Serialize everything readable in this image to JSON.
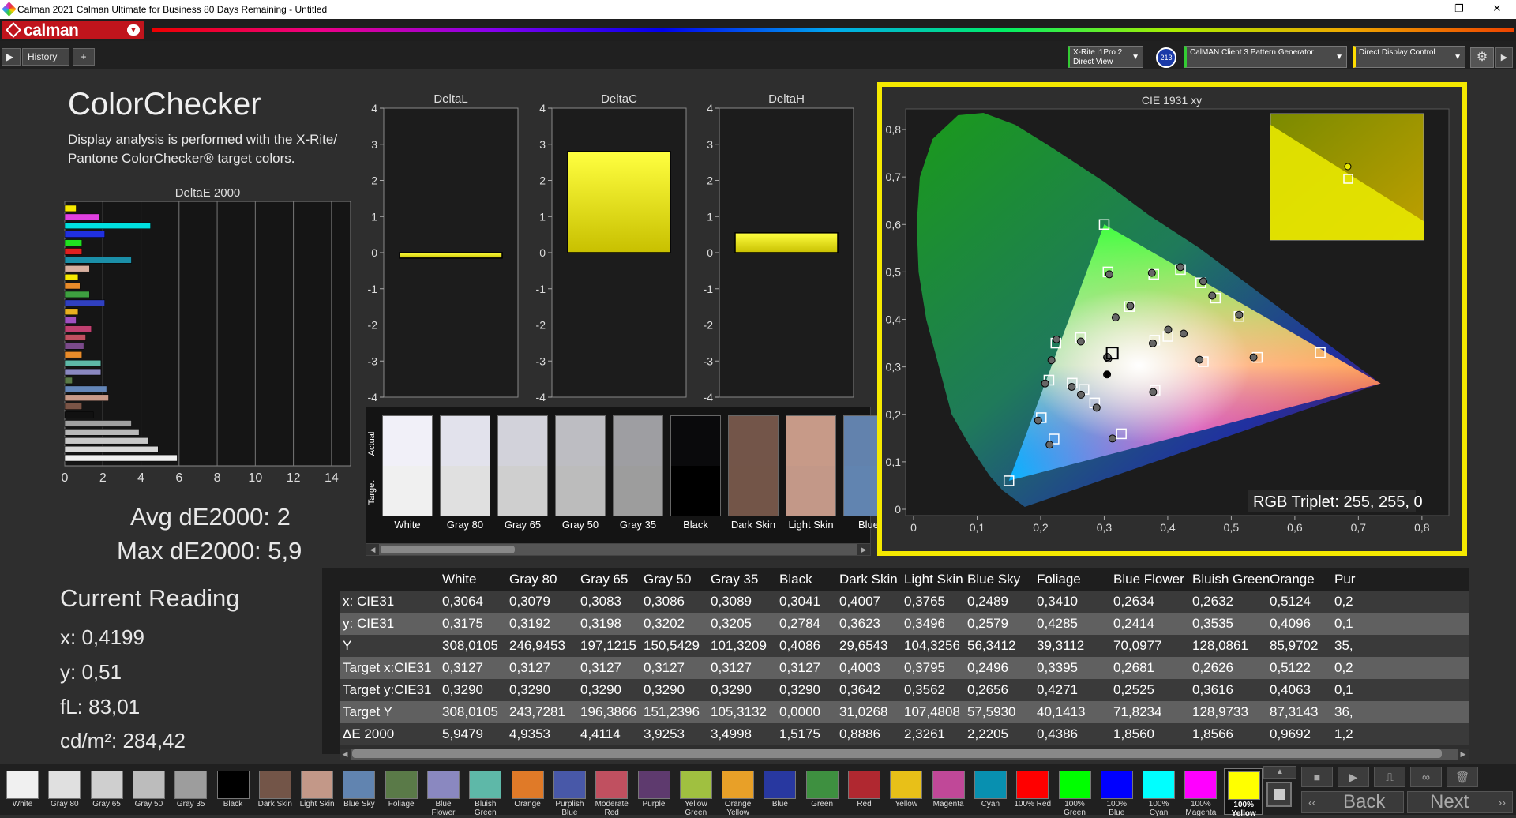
{
  "window": {
    "title": "Calman 2021 Calman Ultimate for Business 80 Days Remaining  - Untitled",
    "minimize": "—",
    "maximize": "❐",
    "close": "✕"
  },
  "brand": {
    "name": "calman",
    "accent": "#c0141c"
  },
  "history": {
    "play": "▶",
    "tab": "History 1",
    "add": "+"
  },
  "devices": [
    {
      "line1": "X-Rite i1Pro 2",
      "line2": "Direct View",
      "badge": "213"
    },
    {
      "line1": "CalMAN Client 3 Pattern Generator",
      "line2": ""
    },
    {
      "line1": "Direct Display Control",
      "line2": ""
    }
  ],
  "settings_icon": "gear-icon",
  "panel": {
    "title": "ColorChecker",
    "description_1": "Display analysis is performed with the X-Rite/",
    "description_2": "Pantone ColorChecker® target colors.",
    "avg": "Avg dE2000: 2",
    "max": "Max dE2000: 5,9",
    "current_reading": "Current Reading",
    "x": "x: 0,4199",
    "y": "y: 0,51",
    "fl": "fL: 83,01",
    "cdm2": "cd/m²: 284,42"
  },
  "chart_data": [
    {
      "type": "bar",
      "title": "DeltaE 2000",
      "orientation": "horizontal",
      "xlim": [
        0,
        15
      ],
      "xticks": [
        "0",
        "2",
        "4",
        "6",
        "8",
        "10",
        "12",
        "14"
      ],
      "values": [
        {
          "v": 0.6,
          "c": "#f5e900"
        },
        {
          "v": 1.8,
          "c": "#e040e0"
        },
        {
          "v": 4.5,
          "c": "#00e0e0"
        },
        {
          "v": 2.1,
          "c": "#2030e0"
        },
        {
          "v": 0.9,
          "c": "#20e020"
        },
        {
          "v": 0.9,
          "c": "#e02020"
        },
        {
          "v": 3.5,
          "c": "#1b8fa8"
        },
        {
          "v": 1.3,
          "c": "#d8b0a0"
        },
        {
          "v": 0.7,
          "c": "#f5e900"
        },
        {
          "v": 0.8,
          "c": "#e88b2a"
        },
        {
          "v": 1.3,
          "c": "#3ea040"
        },
        {
          "v": 2.1,
          "c": "#3040c0"
        },
        {
          "v": 0.7,
          "c": "#e8b020"
        },
        {
          "v": 0.6,
          "c": "#a050c0"
        },
        {
          "v": 1.4,
          "c": "#c04070"
        },
        {
          "v": 1.1,
          "c": "#c05060"
        },
        {
          "v": 1.0,
          "c": "#7a4a8a"
        },
        {
          "v": 0.9,
          "c": "#e88b2a"
        },
        {
          "v": 1.9,
          "c": "#5eb8a8"
        },
        {
          "v": 1.9,
          "c": "#8a88c0"
        },
        {
          "v": 0.4,
          "c": "#5a7a48"
        },
        {
          "v": 2.2,
          "c": "#6486b8"
        },
        {
          "v": 2.3,
          "c": "#c89a88"
        },
        {
          "v": 0.9,
          "c": "#7a5446"
        },
        {
          "v": 1.5,
          "c": "#111111"
        },
        {
          "v": 3.5,
          "c": "#a0a0a0"
        },
        {
          "v": 3.9,
          "c": "#b8b8b8"
        },
        {
          "v": 4.4,
          "c": "#c8c8c8"
        },
        {
          "v": 4.9,
          "c": "#d8d8d8"
        },
        {
          "v": 5.9,
          "c": "#f0f0f0"
        }
      ]
    },
    {
      "type": "bar",
      "title": "DeltaL",
      "ylim": [
        -4,
        4
      ],
      "yticks": [
        "4",
        "3",
        "2",
        "1",
        "0",
        "-1",
        "-2",
        "-3",
        "-4"
      ],
      "values": [
        -0.15
      ]
    },
    {
      "type": "bar",
      "title": "DeltaC",
      "ylim": [
        -4,
        4
      ],
      "yticks": [
        "4",
        "3",
        "2",
        "1",
        "0",
        "-1",
        "-2",
        "-3",
        "-4"
      ],
      "values": [
        2.8
      ]
    },
    {
      "type": "bar",
      "title": "DeltaH",
      "ylim": [
        -4,
        4
      ],
      "yticks": [
        "4",
        "3",
        "2",
        "1",
        "0",
        "-1",
        "-2",
        "-3",
        "-4"
      ],
      "values": [
        0.55
      ]
    },
    {
      "type": "scatter",
      "title": "CIE 1931 xy",
      "xlim": [
        0,
        0.85
      ],
      "ylim": [
        0,
        0.85
      ],
      "xticks": [
        "0",
        "0,1",
        "0,2",
        "0,3",
        "0,4",
        "0,5",
        "0,6",
        "0,7",
        "0,8"
      ],
      "yticks": [
        "0",
        "0,1",
        "0,2",
        "0,3",
        "0,4",
        "0,5",
        "0,6",
        "0,7",
        "0,8"
      ],
      "gamut": [
        [
          0.64,
          0.33
        ],
        [
          0.3,
          0.6
        ],
        [
          0.15,
          0.06
        ]
      ],
      "targets": [
        [
          0.64,
          0.33
        ],
        [
          0.3,
          0.6
        ],
        [
          0.15,
          0.06
        ],
        [
          0.3127,
          0.329
        ],
        [
          0.3127,
          0.329
        ],
        [
          0.4003,
          0.3642
        ],
        [
          0.3795,
          0.3562
        ],
        [
          0.2496,
          0.2656
        ],
        [
          0.3395,
          0.4271
        ],
        [
          0.2681,
          0.2525
        ],
        [
          0.2626,
          0.3616
        ],
        [
          0.5122,
          0.4063
        ],
        [
          0.213,
          0.272
        ],
        [
          0.456,
          0.311
        ],
        [
          0.221,
          0.148
        ],
        [
          0.378,
          0.495
        ],
        [
          0.475,
          0.445
        ],
        [
          0.201,
          0.193
        ],
        [
          0.306,
          0.5
        ],
        [
          0.541,
          0.32
        ],
        [
          0.452,
          0.477
        ],
        [
          0.327,
          0.159
        ],
        [
          0.224,
          0.35
        ],
        [
          0.38,
          0.251
        ],
        [
          0.285,
          0.224
        ],
        [
          0.42,
          0.505
        ]
      ],
      "actual": [
        [
          0.3064,
          0.3175
        ],
        [
          0.4007,
          0.3784
        ],
        [
          0.3765,
          0.3496
        ],
        [
          0.2489,
          0.2579
        ],
        [
          0.341,
          0.4285
        ],
        [
          0.2634,
          0.2414
        ],
        [
          0.2632,
          0.3535
        ],
        [
          0.5124,
          0.4096
        ],
        [
          0.217,
          0.314
        ],
        [
          0.45,
          0.315
        ],
        [
          0.214,
          0.136
        ],
        [
          0.375,
          0.498
        ],
        [
          0.47,
          0.45
        ],
        [
          0.196,
          0.187
        ],
        [
          0.308,
          0.495
        ],
        [
          0.535,
          0.32
        ],
        [
          0.456,
          0.48
        ],
        [
          0.313,
          0.149
        ],
        [
          0.225,
          0.358
        ],
        [
          0.377,
          0.247
        ],
        [
          0.288,
          0.214
        ],
        [
          0.3045,
          0.284
        ],
        [
          0.3045,
          0.32
        ],
        [
          0.4199,
          0.51
        ],
        [
          0.425,
          0.37
        ],
        [
          0.318,
          0.404
        ],
        [
          0.207,
          0.265
        ],
        [
          0.305,
          0.321
        ],
        [
          0.69,
          0.705
        ]
      ],
      "annotation": "RGB Triplet: 255, 255, 0"
    }
  ],
  "swatches": [
    {
      "label": "White",
      "actual": "#f1f0f8",
      "target": "#f0f0f0"
    },
    {
      "label": "Gray 80",
      "actual": "#e2e2ec",
      "target": "#e0e0e0"
    },
    {
      "label": "Gray 65",
      "actual": "#d2d2da",
      "target": "#cfcfcf"
    },
    {
      "label": "Gray 50",
      "actual": "#bdbdc2",
      "target": "#bcbcbc"
    },
    {
      "label": "Gray 35",
      "actual": "#9e9ea2",
      "target": "#9d9d9d"
    },
    {
      "label": "Black",
      "actual": "#0a0a0c",
      "target": "#000000"
    },
    {
      "label": "Dark Skin",
      "actual": "#735549",
      "target": "#735548"
    },
    {
      "label": "Light Skin",
      "actual": "#c79a88",
      "target": "#c39888"
    },
    {
      "label": "Blue",
      "actual": "#6282ad",
      "target": "#6184b0"
    }
  ],
  "swatch_axis": {
    "actual": "Actual",
    "target": "Target"
  },
  "table": {
    "columns": [
      "",
      "White",
      "Gray 80",
      "Gray 65",
      "Gray 50",
      "Gray 35",
      "Black",
      "Dark Skin",
      "Light Skin",
      "Blue Sky",
      "Foliage",
      "Blue Flower",
      "Bluish Green",
      "Orange",
      "Pur"
    ],
    "rows": [
      [
        "x: CIE31",
        "0,3064",
        "0,3079",
        "0,3083",
        "0,3086",
        "0,3089",
        "0,3041",
        "0,4007",
        "0,3765",
        "0,2489",
        "0,3410",
        "0,2634",
        "0,2632",
        "0,5124",
        "0,2"
      ],
      [
        "y: CIE31",
        "0,3175",
        "0,3192",
        "0,3198",
        "0,3202",
        "0,3205",
        "0,2784",
        "0,3623",
        "0,3496",
        "0,2579",
        "0,4285",
        "0,2414",
        "0,3535",
        "0,4096",
        "0,1"
      ],
      [
        "Y",
        "308,0105",
        "246,9453",
        "197,1215",
        "150,5429",
        "101,3209",
        "0,4086",
        "29,6543",
        "104,3256",
        "56,3412",
        "39,3112",
        "70,0977",
        "128,0861",
        "85,9702",
        "35,"
      ],
      [
        "Target x:CIE31",
        "0,3127",
        "0,3127",
        "0,3127",
        "0,3127",
        "0,3127",
        "0,3127",
        "0,4003",
        "0,3795",
        "0,2496",
        "0,3395",
        "0,2681",
        "0,2626",
        "0,5122",
        "0,2"
      ],
      [
        "Target y:CIE31",
        "0,3290",
        "0,3290",
        "0,3290",
        "0,3290",
        "0,3290",
        "0,3290",
        "0,3642",
        "0,3562",
        "0,2656",
        "0,4271",
        "0,2525",
        "0,3616",
        "0,4063",
        "0,1"
      ],
      [
        "Target Y",
        "308,0105",
        "243,7281",
        "196,3866",
        "151,2396",
        "105,3132",
        "0,0000",
        "31,0268",
        "107,4808",
        "57,5930",
        "40,1413",
        "71,8234",
        "128,9733",
        "87,3143",
        "36,"
      ],
      [
        "ΔE 2000",
        "5,9479",
        "4,9353",
        "4,4114",
        "3,9253",
        "3,4998",
        "1,5175",
        "0,8886",
        "2,3261",
        "2,2205",
        "0,4386",
        "1,8560",
        "1,8566",
        "0,9692",
        "1,2"
      ]
    ]
  },
  "bottom_swatches": [
    {
      "l1": "White",
      "l2": "",
      "c": "#f0f0f0"
    },
    {
      "l1": "Gray 80",
      "l2": "",
      "c": "#e0e0e0"
    },
    {
      "l1": "Gray 65",
      "l2": "",
      "c": "#cfcfcf"
    },
    {
      "l1": "Gray 50",
      "l2": "",
      "c": "#bcbcbc"
    },
    {
      "l1": "Gray 35",
      "l2": "",
      "c": "#9d9d9d"
    },
    {
      "l1": "Black",
      "l2": "",
      "c": "#000000"
    },
    {
      "l1": "Dark Skin",
      "l2": "",
      "c": "#735548"
    },
    {
      "l1": "Light Skin",
      "l2": "",
      "c": "#c39888"
    },
    {
      "l1": "Blue Sky",
      "l2": "",
      "c": "#6184b0"
    },
    {
      "l1": "Foliage",
      "l2": "",
      "c": "#5a7a48"
    },
    {
      "l1": "Blue",
      "l2": "Flower",
      "c": "#8a88c0"
    },
    {
      "l1": "Bluish",
      "l2": "Green",
      "c": "#5eb8a8"
    },
    {
      "l1": "Orange",
      "l2": "",
      "c": "#e07a28"
    },
    {
      "l1": "Purplish",
      "l2": "Blue",
      "c": "#4858a8"
    },
    {
      "l1": "Moderate",
      "l2": "Red",
      "c": "#c05060"
    },
    {
      "l1": "Purple",
      "l2": "",
      "c": "#5e3a6e"
    },
    {
      "l1": "Yellow",
      "l2": "Green",
      "c": "#a0c040"
    },
    {
      "l1": "Orange",
      "l2": "Yellow",
      "c": "#e8a028"
    },
    {
      "l1": "Blue",
      "l2": "",
      "c": "#2838a0"
    },
    {
      "l1": "Green",
      "l2": "",
      "c": "#3e9040"
    },
    {
      "l1": "Red",
      "l2": "",
      "c": "#b02830"
    },
    {
      "l1": "Yellow",
      "l2": "",
      "c": "#e8c018"
    },
    {
      "l1": "Magenta",
      "l2": "",
      "c": "#c04898"
    },
    {
      "l1": "Cyan",
      "l2": "",
      "c": "#0890b0"
    },
    {
      "l1": "100% Red",
      "l2": "",
      "c": "#ff0000"
    },
    {
      "l1": "100%",
      "l2": "Green",
      "c": "#00ff00"
    },
    {
      "l1": "100%",
      "l2": "Blue",
      "c": "#0000ff"
    },
    {
      "l1": "100%",
      "l2": "Cyan",
      "c": "#00ffff"
    },
    {
      "l1": "100%",
      "l2": "Magenta",
      "c": "#ff00ff"
    },
    {
      "l1": "100%",
      "l2": "Yellow",
      "c": "#ffff00"
    }
  ],
  "nav": {
    "back": "Back",
    "next": "Next"
  }
}
